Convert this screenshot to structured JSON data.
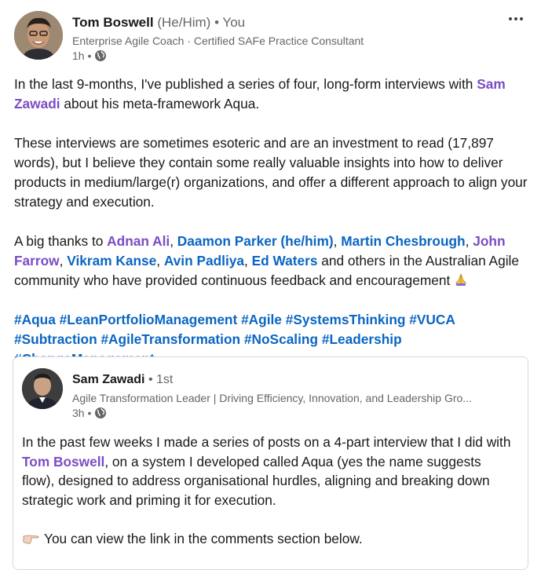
{
  "post": {
    "author": {
      "name": "Tom Boswell",
      "pronouns": "(He/Him)",
      "relation": "• You",
      "headline": "Enterprise Agile Coach · Certified SAFe Practice Consultant",
      "time": "1h •"
    },
    "paragraph1": {
      "part1": "In the last 9-months, I've published a series of four, long-form interviews with ",
      "mention": "Sam Zawadi",
      "part2": " about his meta-framework Aqua."
    },
    "paragraph2": "These interviews are sometimes esoteric and are an investment to read (17,897 words), but I believe they contain some really valuable insights into how to deliver products in medium/large(r) organizations, and offer a different approach to align your strategy and execution.",
    "paragraph3": {
      "intro": "A big thanks to ",
      "mentions": [
        "Adnan Ali",
        "Daamon Parker (he/him)",
        "Martin Chesbrough",
        "John Farrow",
        "Vikram Kanse",
        "Avin Padliya",
        "Ed Waters"
      ],
      "sep": ", ",
      "outro": " and others in the Australian Agile community who have provided continuous feedback and encouragement "
    },
    "hashtags": [
      "#Aqua",
      "#LeanPortfolioManagement",
      "#Agile",
      "#SystemsThinking",
      "#VUCA",
      "#Subtraction",
      "#AgileTransformation",
      "#NoScaling",
      "#Leadership",
      "#ChangeManagement"
    ]
  },
  "shared_post": {
    "author": {
      "name": "Sam Zawadi",
      "degree": "• 1st",
      "headline": "Agile Transformation Leader | Driving Efficiency, Innovation, and Leadership Gro...",
      "time": "3h •"
    },
    "paragraph1": {
      "part1": "In the past few weeks I made a series of posts on a 4-part interview that I did with ",
      "mention": "Tom Boswell",
      "part2": ", on a system I developed called Aqua (yes the name suggests flow), designed to address organisational hurdles, aligning and breaking down strategic work and priming it for execution."
    },
    "paragraph2": "You can view the link in the comments section below."
  },
  "icons": {
    "globe": "globe-icon",
    "more": "more-options-icon",
    "hands": "folded-hands-emoji",
    "point": "pointing-right-emoji"
  },
  "colors": {
    "mention": "#7a4dc4",
    "hashtag": "#0a66c2",
    "secondary_text": "#666666"
  }
}
